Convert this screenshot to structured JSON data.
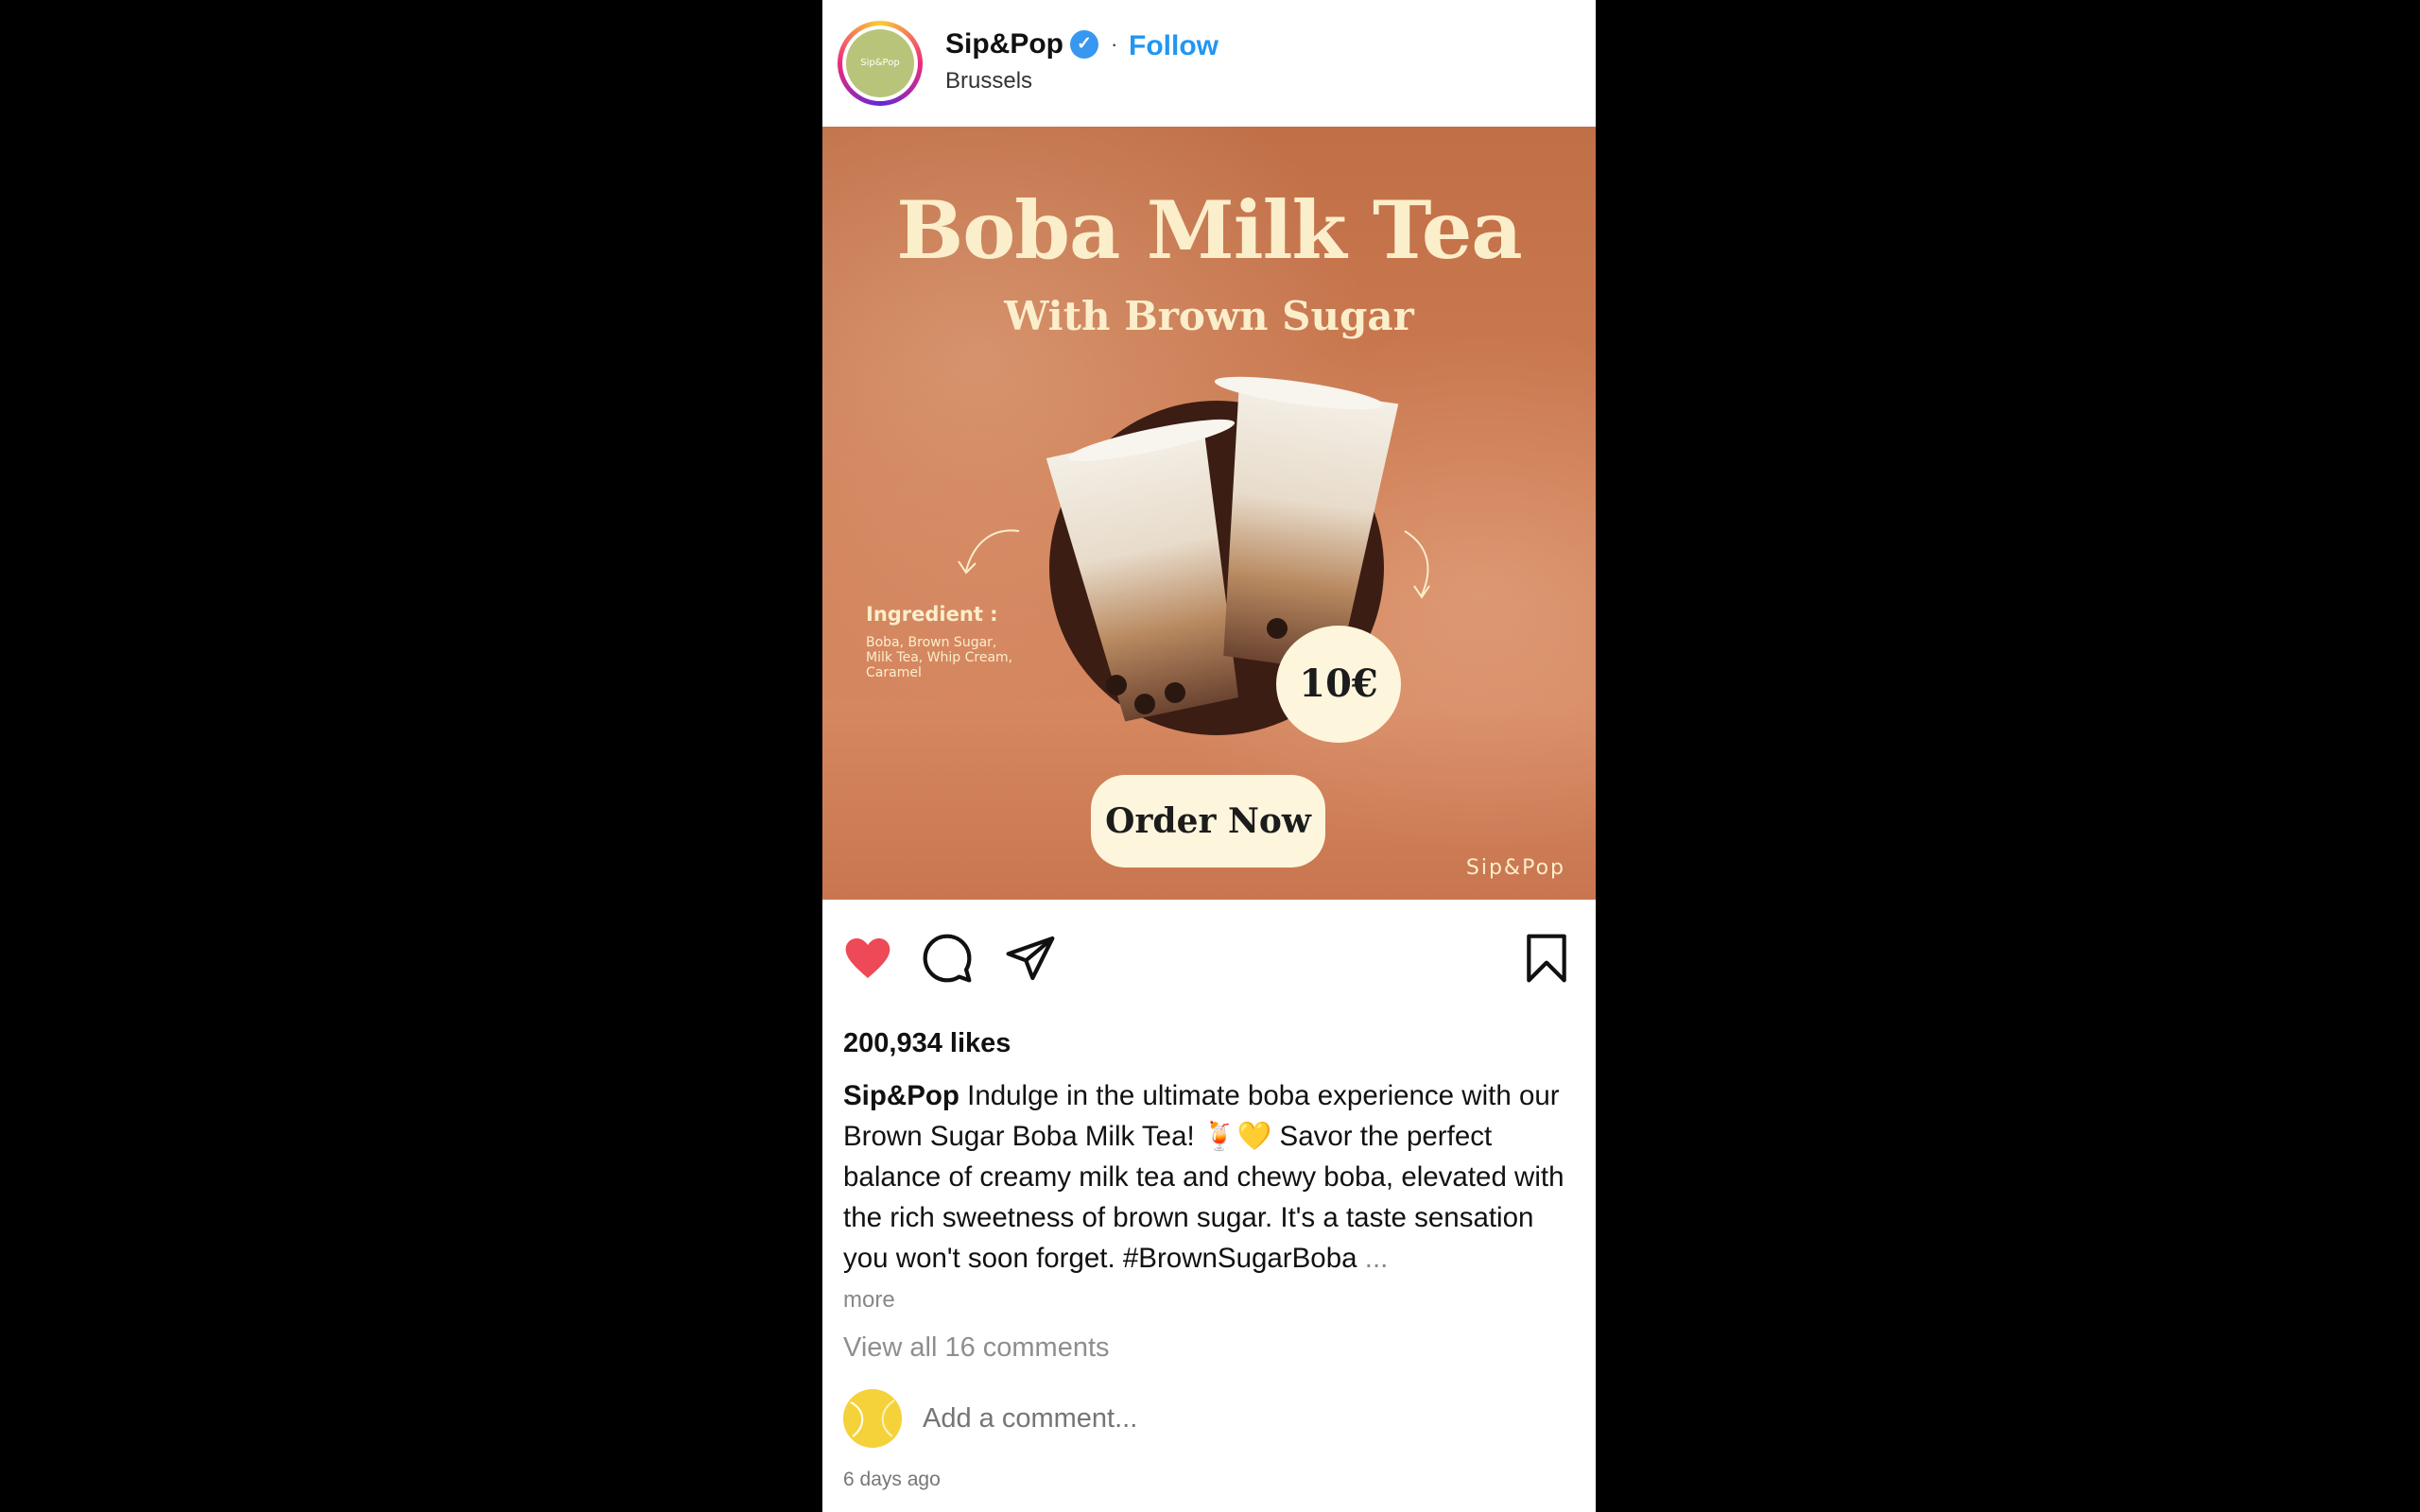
{
  "header": {
    "avatar_text": "Sip&Pop",
    "username": "Sip&Pop",
    "follow_label": "Follow",
    "separator": "·",
    "location": "Brussels"
  },
  "media": {
    "title": "Boba Milk Tea",
    "subtitle": "With Brown Sugar",
    "ingredient_heading": "Ingredient :",
    "ingredient_text": "Boba, Brown Sugar, Milk Tea, Whip Cream, Caramel",
    "price": "10€",
    "order_label": "Order Now",
    "watermark": "Sip&Pop"
  },
  "actions": {
    "liked": true,
    "like_icon": "heart-icon",
    "comment_icon": "comment-icon",
    "share_icon": "paper-plane-icon",
    "save_icon": "bookmark-icon"
  },
  "likes": "200,934 likes",
  "caption": {
    "username": "Sip&Pop",
    "text": "Indulge in the ultimate boba experience with our Brown Sugar Boba Milk Tea! 🍹💛 Savor the perfect balance of creamy milk tea and chewy boba, elevated with the rich sweetness of brown sugar. It's a taste sensation you won't soon forget. #BrownSugarBoba",
    "ellipsis": "...",
    "more": "more"
  },
  "comments": {
    "view_all": "View all 16 comments",
    "placeholder": "Add a comment..."
  },
  "timestamp": "6 days ago",
  "colors": {
    "accent": "#2196f3",
    "heart": "#ed4956",
    "media_bg": "#cd7b52",
    "cream": "#fdf6dd"
  }
}
